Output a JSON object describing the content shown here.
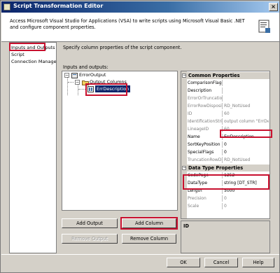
{
  "window": {
    "title": "Script Transformation Editor",
    "close_glyph": "×"
  },
  "header": {
    "description": "Access Microsoft Visual Studio for Applications (VSA) to write scripts using Microsoft Visual Basic .NET and configure component properties."
  },
  "nav": {
    "items": [
      "Inputs and Outputs",
      "Script",
      "Connection Managers"
    ]
  },
  "main": {
    "subtitle": "Specify column properties of the script component.",
    "io_label": "Inputs and outputs:"
  },
  "tree": {
    "root": "ErrorOutput",
    "child": "Output Columns",
    "leaf": "ErrDescription",
    "expander": "−"
  },
  "properties": {
    "common_header": "Common Properties",
    "common": [
      {
        "name": "ComparisonFlags",
        "value": "",
        "grey": false
      },
      {
        "name": "Description",
        "value": "",
        "grey": false
      },
      {
        "name": "ErrorOrTruncation",
        "value": "",
        "grey": true
      },
      {
        "name": "ErrorRowDisposition",
        "value": "RD_NotUsed",
        "grey": true
      },
      {
        "name": "ID",
        "value": "60",
        "grey": true
      },
      {
        "name": "IdentificationString",
        "value": "output column \"ErrDesc",
        "grey": true
      },
      {
        "name": "LineageID",
        "value": "60",
        "grey": true
      },
      {
        "name": "Name",
        "value": "ErrDescription",
        "grey": false
      },
      {
        "name": "SortKeyPosition",
        "value": "0",
        "grey": false
      },
      {
        "name": "SpecialFlags",
        "value": "0",
        "grey": false
      },
      {
        "name": "TruncationRowDisp",
        "value": "RD_NotUsed",
        "grey": true
      }
    ],
    "datatype_header": "Data Type Properties",
    "datatype": [
      {
        "name": "CodePage",
        "value": "1252",
        "grey": false
      },
      {
        "name": "DataType",
        "value": "string [DT_STR]",
        "grey": false
      },
      {
        "name": "Length",
        "value": "5000",
        "grey": false
      },
      {
        "name": "Precision",
        "value": "0",
        "grey": true
      },
      {
        "name": "Scale",
        "value": "0",
        "grey": true
      }
    ],
    "collapse_glyph": "−"
  },
  "description_pane": {
    "title": "ID"
  },
  "buttons": {
    "add_output": "Add Output",
    "add_column": "Add Column",
    "remove_output": "Remove Output",
    "remove_column": "Remove Column",
    "ok": "OK",
    "cancel": "Cancel",
    "help": "Help"
  },
  "colors": {
    "highlight": "#c8102e",
    "titlebar": "#0a246a",
    "selection": "#0a246a"
  }
}
